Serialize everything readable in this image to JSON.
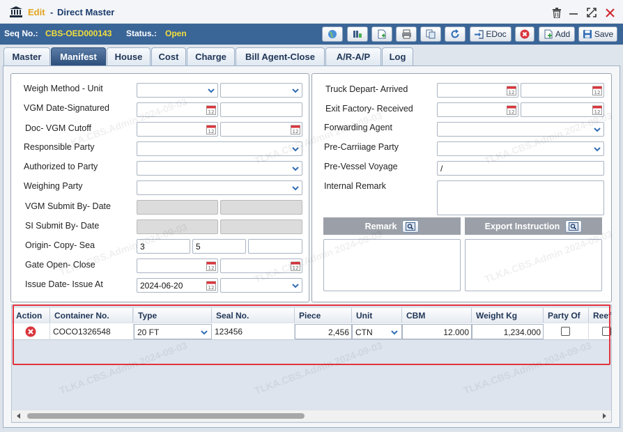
{
  "window": {
    "mode": "Edit",
    "separator": "-",
    "title": "Direct Master"
  },
  "seq": {
    "seq_label": "Seq No.:",
    "seq_value": "CBS-OED000143",
    "status_label": "Status.:",
    "status_value": "Open"
  },
  "toolbar": {
    "edoc_label": "EDoc",
    "add_label": "Add",
    "save_label": "Save"
  },
  "tabs": [
    "Master",
    "Manifest",
    "House",
    "Cost",
    "Charge",
    "Bill Agent-Close",
    "A/R-A/P",
    "Log"
  ],
  "active_tab": "Manifest",
  "left_form": {
    "weigh_method_label": "Weigh Method - Unit",
    "vgm_date_label": "VGM Date-Signatured",
    "doc_vgm_cutoff_label": "Doc- VGM Cutoff",
    "responsible_party_label": "Responsible Party",
    "authorized_to_party_label": "Authorized to Party",
    "weighing_party_label": "Weighing Party",
    "vgm_submit_label": "VGM Submit By- Date",
    "si_submit_label": "SI Submit By- Date",
    "origin_copy_sea_label": "Origin- Copy- Sea",
    "origin_value": "3",
    "copy_value": "5",
    "sea_value": "",
    "gate_open_close_label": "Gate Open- Close",
    "issue_date_label": "Issue Date- Issue At",
    "issue_date_value": "2024-06-20"
  },
  "right_form": {
    "truck_depart_label": "Truck Depart- Arrived",
    "exit_factory_label": "Exit Factory- Received",
    "forwarding_agent_label": "Forwarding Agent",
    "pre_carriage_label": "Pre-Carriiage Party",
    "pre_vessel_label": "Pre-Vessel Voyage",
    "pre_vessel_value": "/",
    "internal_remark_label": "Internal Remark",
    "remark_header": "Remark",
    "export_instruction_header": "Export Instruction"
  },
  "grid": {
    "columns": [
      "Action",
      "Container No.",
      "Type",
      "Seal No.",
      "Piece",
      "Unit",
      "CBM",
      "Weight Kg",
      "Party Of",
      "Reef"
    ],
    "rows": [
      {
        "container_no": "COCO1326548",
        "type": "20 FT",
        "seal_no": "123456",
        "piece": "2,456",
        "unit": "CTN",
        "cbm": "12.000",
        "weight_kg": "1,234.000",
        "party_of": false,
        "reef": false
      }
    ]
  },
  "watermark": "TLKA.CBS.Admin 2024-09-03",
  "colors": {
    "header_bar": "#3a6597",
    "accent_yellow": "#f3de3e",
    "title_orange": "#e2a31b",
    "highlight_red": "#e2333e"
  }
}
